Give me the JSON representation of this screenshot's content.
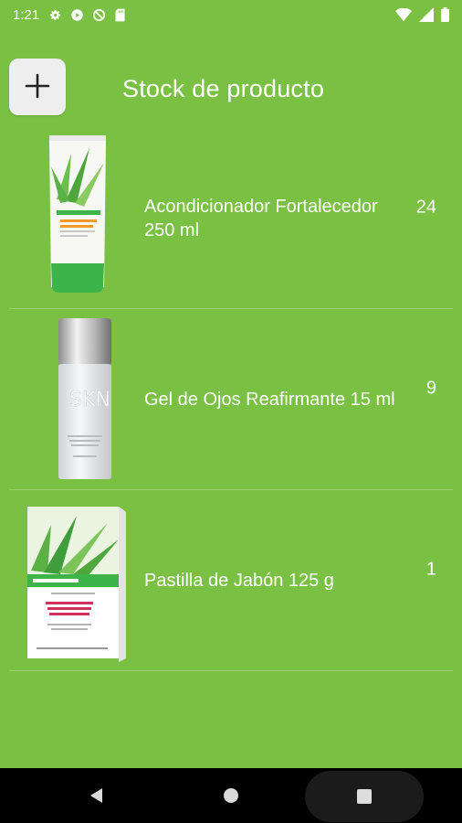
{
  "status_bar": {
    "time": "1:21",
    "icons_left": [
      "gear-icon",
      "play-icon",
      "blocked-icon",
      "sd-card-icon"
    ],
    "icons_right": [
      "wifi-icon",
      "signal-icon",
      "battery-icon"
    ]
  },
  "header": {
    "add_icon": "plus-icon",
    "title": "Stock de producto"
  },
  "products": [
    {
      "name": "Acondicionador Fortalecedor 250 ml",
      "quantity": "24",
      "image": "conditioner-tube"
    },
    {
      "name": "Gel de Ojos Reafirmante 15 ml",
      "quantity": "9",
      "image": "eye-gel-bottle"
    },
    {
      "name": "Pastilla de Jabón 125 g",
      "quantity": "1",
      "image": "soap-box"
    }
  ],
  "nav": {
    "back": "back-icon",
    "home": "home-icon",
    "recents": "recents-icon"
  },
  "colors": {
    "background": "#7ac143",
    "nav_bar": "#000000",
    "button_bg": "#eeeeee"
  }
}
